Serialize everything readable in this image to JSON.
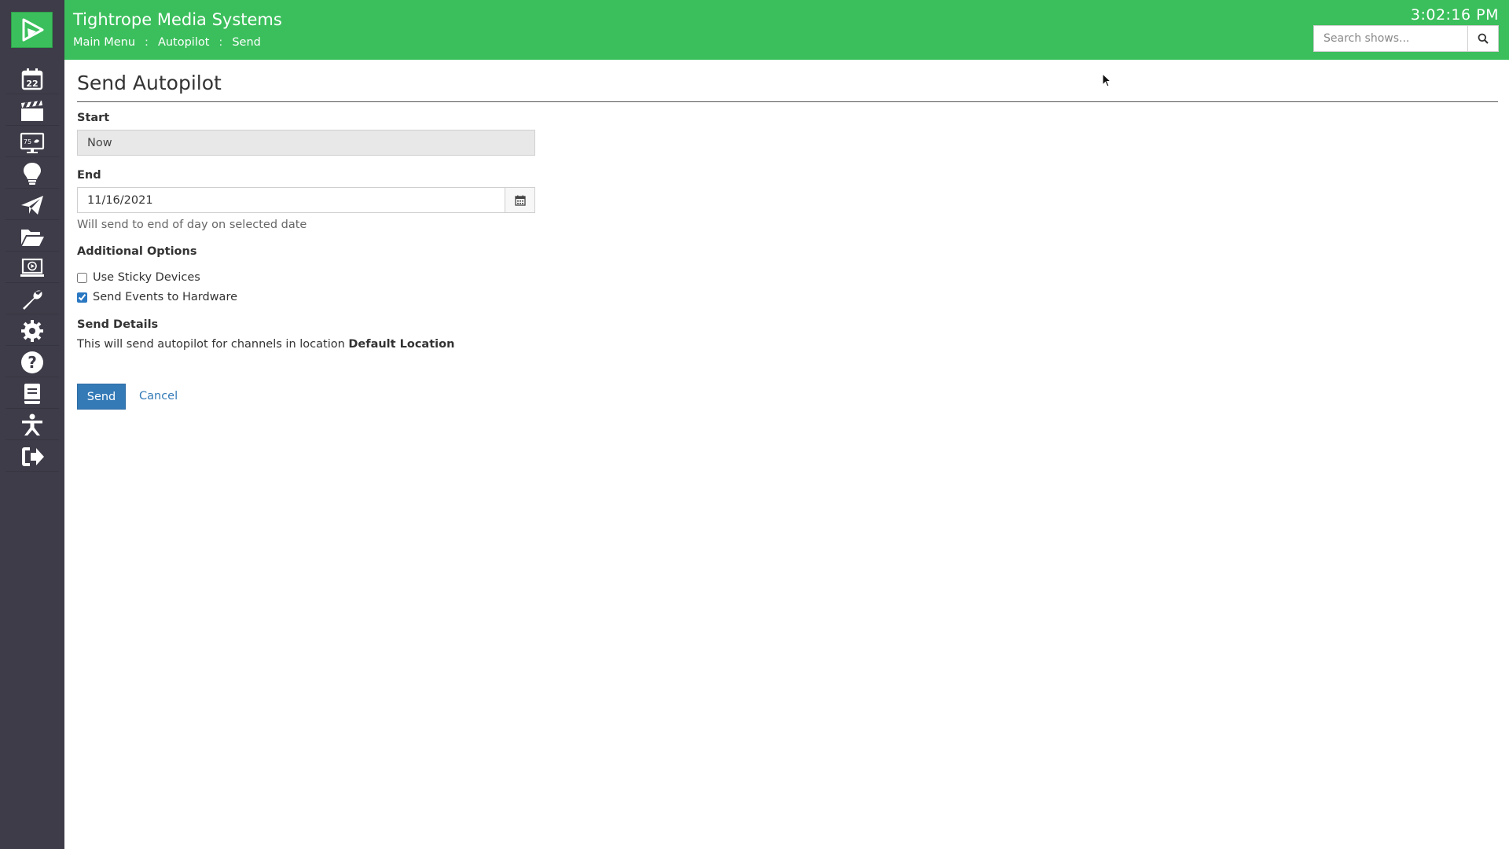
{
  "app": {
    "title": "Tightrope Media Systems",
    "clock": "3:02:16 PM"
  },
  "breadcrumb": [
    {
      "label": "Main Menu"
    },
    {
      "label": "Autopilot"
    },
    {
      "label": "Send"
    }
  ],
  "breadcrumb_separator": ":",
  "search": {
    "placeholder": "Search shows..."
  },
  "sidebar": {
    "logo_icon": "cablecast-play-logo",
    "items": [
      {
        "icon": "calendar-icon",
        "label": "22"
      },
      {
        "icon": "clapperboard-icon"
      },
      {
        "icon": "bulletin-display-icon",
        "label": "75"
      },
      {
        "icon": "lightbulb-icon"
      },
      {
        "icon": "paper-plane-icon"
      },
      {
        "icon": "folder-open-icon"
      },
      {
        "icon": "monitor-play-icon"
      },
      {
        "icon": "wrench-icon"
      },
      {
        "icon": "gear-icon"
      },
      {
        "icon": "question-circle-icon"
      },
      {
        "icon": "book-icon"
      },
      {
        "icon": "accessibility-icon"
      },
      {
        "icon": "sign-out-icon"
      }
    ]
  },
  "page": {
    "title": "Send Autopilot",
    "start": {
      "label": "Start",
      "value": "Now"
    },
    "end": {
      "label": "End",
      "value": "11/16/2021",
      "help": "Will send to end of day on selected date"
    },
    "options": {
      "heading": "Additional Options",
      "items": [
        {
          "label": "Use Sticky Devices",
          "checked": false
        },
        {
          "label": "Send Events to Hardware",
          "checked": true
        }
      ]
    },
    "details": {
      "heading": "Send Details",
      "text": "This will send autopilot for channels in location",
      "location": "Default Location"
    },
    "actions": {
      "send": "Send",
      "cancel": "Cancel"
    }
  },
  "colors": {
    "header": "#3bbf5c",
    "sidebar": "#3d3c48",
    "primary": "#337ab7"
  }
}
